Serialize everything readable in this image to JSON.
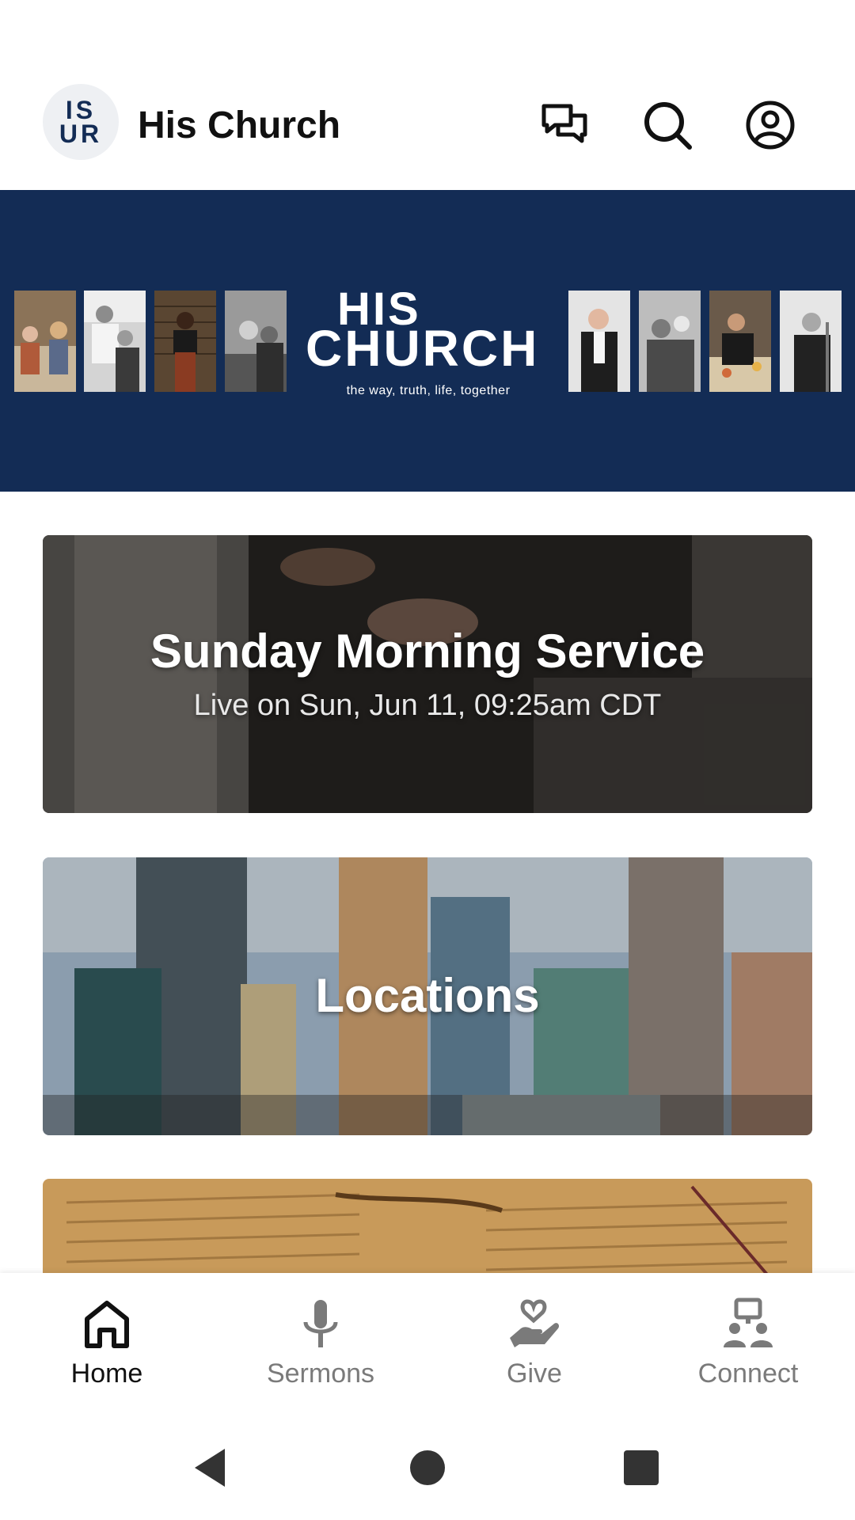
{
  "header": {
    "logo_line1": "IS",
    "logo_line2": "UR",
    "title": "His Church",
    "icons": [
      "chat-icon",
      "search-icon",
      "account-icon"
    ]
  },
  "banner": {
    "brand_line1": "HIS",
    "brand_line2": "CHURCH",
    "tagline": "the way, truth, life, together",
    "colors": {
      "background": "#132c55"
    }
  },
  "cards": [
    {
      "title": "Sunday Morning Service",
      "subtitle": "Live on Sun, Jun 11, 09:25am CDT"
    },
    {
      "title": "Locations"
    },
    {
      "title": ""
    }
  ],
  "bottom_nav": {
    "items": [
      {
        "label": "Home",
        "icon": "home-icon",
        "active": true
      },
      {
        "label": "Sermons",
        "icon": "microphone-icon",
        "active": false
      },
      {
        "label": "Give",
        "icon": "give-heart-hand-icon",
        "active": false
      },
      {
        "label": "Connect",
        "icon": "connect-people-icon",
        "active": false
      }
    ]
  },
  "system_nav": [
    "back-icon",
    "home-circle-icon",
    "recents-icon"
  ]
}
